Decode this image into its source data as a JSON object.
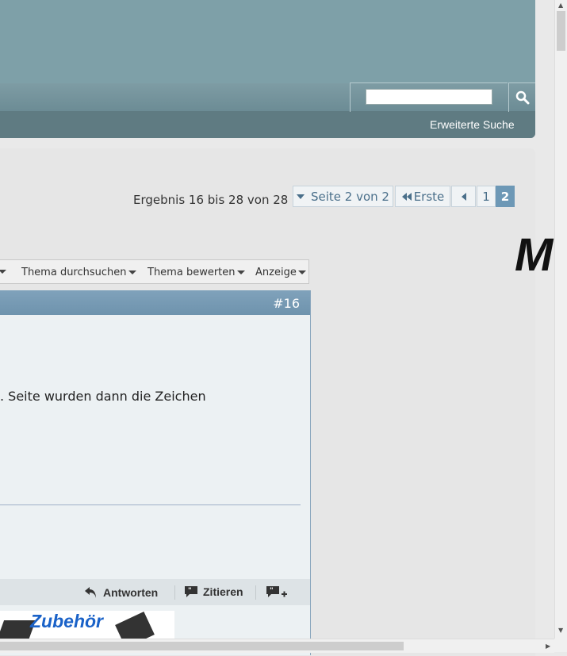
{
  "header": {
    "search_placeholder": "",
    "advanced_search": "Erweiterte Suche",
    "search_button_icon": "magnifier-icon",
    "accent": "#7ea0a8"
  },
  "pagination": {
    "result_text": "Ergebnis 16 bis 28 von 28",
    "page_select": "Seite 2 von 2",
    "first": "Erste",
    "pages": [
      "1",
      "2"
    ],
    "current_page": "2"
  },
  "thread_tools": {
    "items": [
      "Thema durchsuchen",
      "Thema bewerten",
      "Anzeige"
    ]
  },
  "post": {
    "number": "#16",
    "text": ". Seite wurden dann die Zeichen",
    "actions": {
      "reply": "Antworten",
      "quote": "Zitieren"
    },
    "header_color": "#6e93ad"
  },
  "banner": {
    "text": "Zubehör"
  },
  "ad_logo": {
    "text": "M"
  }
}
